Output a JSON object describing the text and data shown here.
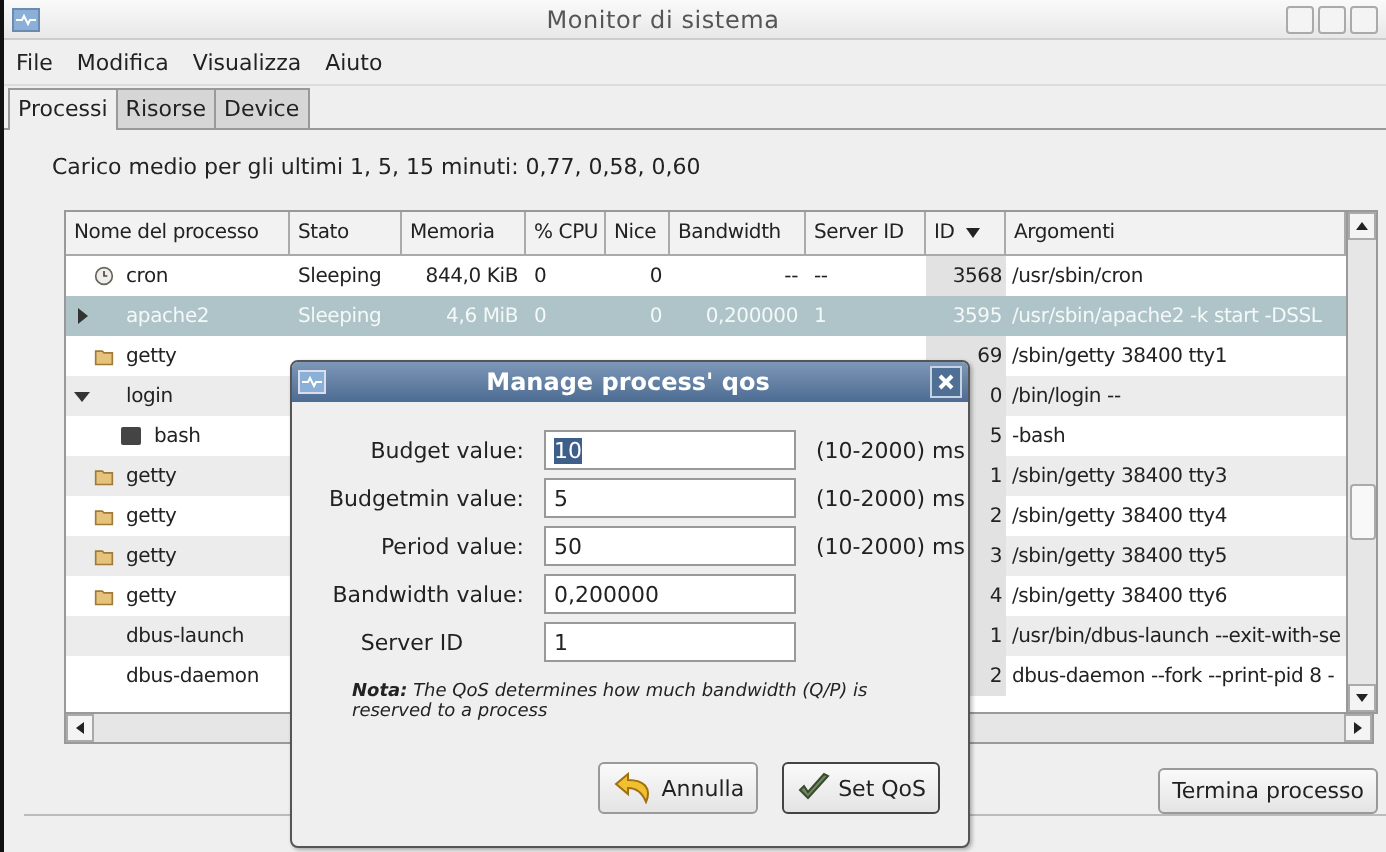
{
  "window": {
    "title": "Monitor di sistema"
  },
  "menu": [
    "File",
    "Modifica",
    "Visualizza",
    "Aiuto"
  ],
  "tabs": [
    {
      "label": "Processi",
      "selected": true
    },
    {
      "label": "Risorse",
      "selected": false
    },
    {
      "label": "Device",
      "selected": false
    }
  ],
  "load_label": "Carico medio per gli ultimi 1, 5, 15 minuti: 0,77, 0,58, 0,60",
  "table": {
    "columns": [
      "Nome del processo",
      "Stato",
      "Memoria",
      "% CPU",
      "Nice",
      "Bandwidth",
      "Server ID",
      "ID",
      "Argomenti"
    ],
    "rows": [
      {
        "kind": "service",
        "selected": false,
        "cells": [
          "cron",
          "Sleeping",
          "844,0 KiB",
          "0",
          "0",
          "--",
          "--",
          "3568",
          "/usr/sbin/cron"
        ]
      },
      {
        "kind": "plain",
        "selected": true,
        "expanded": false,
        "cells": [
          "apache2",
          "Sleeping",
          "4,6 MiB",
          "0",
          "0",
          "0,200000",
          "1",
          "3595",
          "/usr/sbin/apache2 -k start -DSSL"
        ]
      },
      {
        "kind": "tty",
        "selected": false,
        "cells": [
          "getty",
          "",
          "",
          "",
          "",
          "",
          "",
          "69",
          "/sbin/getty 38400 tty1"
        ]
      },
      {
        "kind": "plain",
        "selected": false,
        "expanded": true,
        "cells": [
          "login",
          "",
          "",
          "",
          "",
          "",
          "",
          "0",
          "/bin/login --"
        ],
        "children": [
          {
            "kind": "shell",
            "selected": false,
            "cells": [
              "bash",
              "",
              "",
              "",
              "",
              "",
              "",
              "5",
              "-bash"
            ]
          }
        ]
      },
      {
        "kind": "tty",
        "selected": false,
        "cells": [
          "getty",
          "",
          "",
          "",
          "",
          "",
          "",
          "1",
          "/sbin/getty 38400 tty3"
        ]
      },
      {
        "kind": "tty",
        "selected": false,
        "cells": [
          "getty",
          "",
          "",
          "",
          "",
          "",
          "",
          "2",
          "/sbin/getty 38400 tty4"
        ]
      },
      {
        "kind": "tty",
        "selected": false,
        "cells": [
          "getty",
          "",
          "",
          "",
          "",
          "",
          "",
          "3",
          "/sbin/getty 38400 tty5"
        ]
      },
      {
        "kind": "tty",
        "selected": false,
        "cells": [
          "getty",
          "",
          "",
          "",
          "",
          "",
          "",
          "4",
          "/sbin/getty 38400 tty6"
        ]
      },
      {
        "kind": "plain",
        "selected": false,
        "cells": [
          "dbus-launch",
          "",
          "",
          "",
          "",
          "",
          "",
          "1",
          "/usr/bin/dbus-launch --exit-with-se"
        ]
      },
      {
        "kind": "plain",
        "selected": false,
        "cells": [
          "dbus-daemon",
          "",
          "",
          "",
          "",
          "",
          "",
          "2",
          "dbus-daemon --fork --print-pid 8 -"
        ]
      }
    ]
  },
  "end_button": "Termina processo",
  "dialog": {
    "title": "Manage process' qos",
    "fields": [
      {
        "label": "Budget value:",
        "value": "10",
        "unit": "(10-2000) ms",
        "selected": true
      },
      {
        "label": "Budgetmin value:",
        "value": "5",
        "unit": "(10-2000) ms",
        "selected": false
      },
      {
        "label": "Period value:",
        "value": "50",
        "unit": "(10-2000) ms",
        "selected": false
      },
      {
        "label": "Bandwidth value:",
        "value": "0,200000",
        "selected": false
      },
      {
        "label": "Server ID",
        "value": "1",
        "selected": false
      }
    ],
    "note": "**Nota:** The QoS determines how much bandwidth (Q/P) is reserved to a process",
    "buttons": [
      {
        "label": "Annulla",
        "kind": "cancel"
      },
      {
        "label": "Set QoS",
        "kind": "apply"
      }
    ]
  }
}
